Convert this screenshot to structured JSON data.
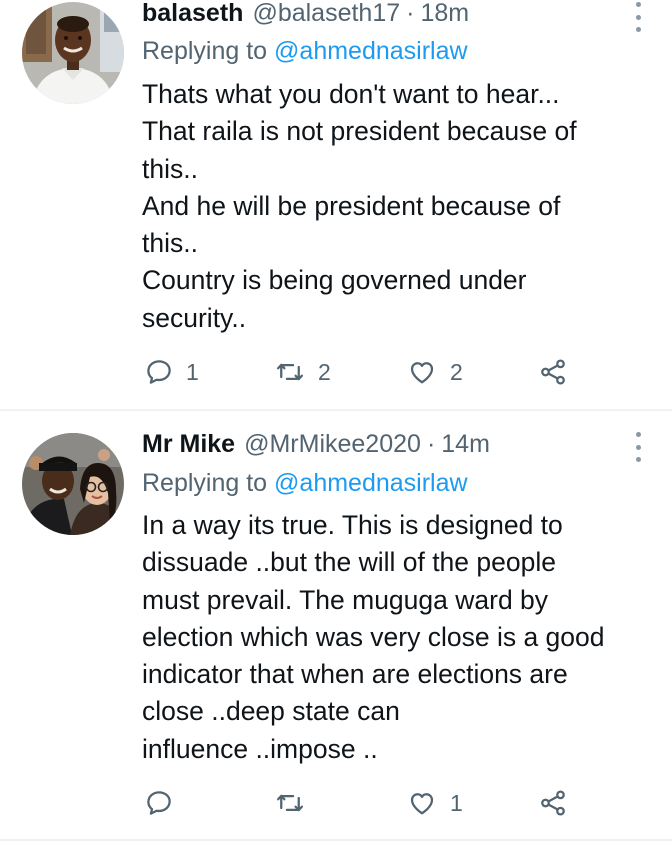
{
  "tweets": [
    {
      "display_name": "balaseth",
      "handle": "@balaseth17",
      "separator": "·",
      "time": "18m",
      "replying_prefix": "Replying to",
      "replying_to": "@ahmednasirlaw",
      "text_lines": [
        "Thats what you don't want to hear...",
        "That raila is not president because of",
        "this..",
        "And he will be president because of",
        "this..",
        "Country is being governed under",
        "security.."
      ],
      "reply_count": "1",
      "retweet_count": "2",
      "like_count": "2"
    },
    {
      "display_name": "Mr Mike",
      "handle": "@MrMikee2020",
      "separator": "·",
      "time": "14m",
      "replying_prefix": "Replying to",
      "replying_to": "@ahmednasirlaw",
      "text_lines": [
        "In a way its true. This is designed to",
        "dissuade ..but the will of the people",
        "must prevail. The muguga ward by",
        "election which was very close is a good",
        "indicator that when are elections are",
        "close ..deep state can",
        "influence ..impose .."
      ],
      "reply_count": "",
      "retweet_count": "",
      "like_count": "1"
    }
  ],
  "icons": {
    "reply": "reply-bubble-icon",
    "retweet": "retweet-icon",
    "like": "heart-icon",
    "share": "share-icon",
    "more": "more-vertical-icon"
  },
  "colors": {
    "text": "#0f1419",
    "secondary": "#536471",
    "link": "#1d9bf0",
    "divider": "#eff3f4"
  }
}
